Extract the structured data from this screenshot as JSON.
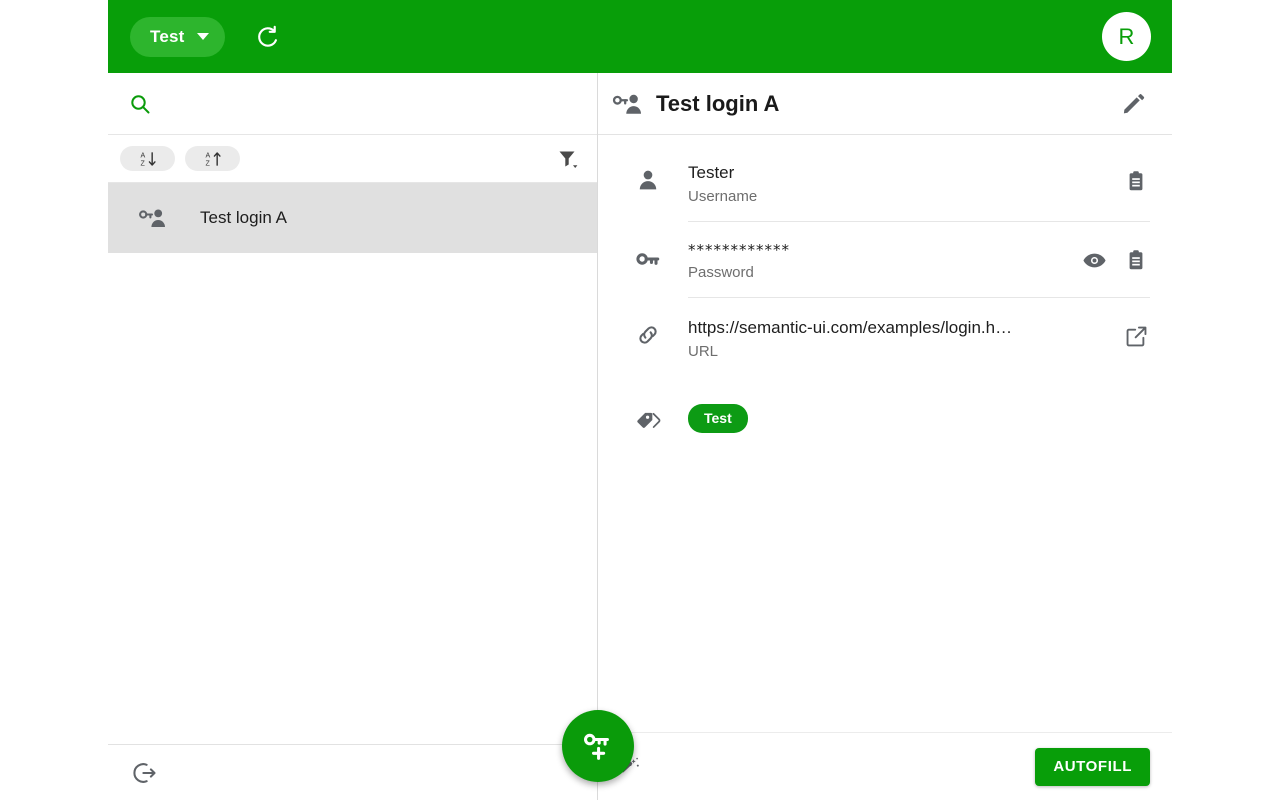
{
  "theme": {
    "primary_green": "#089e09",
    "chip_green": "#2db52d",
    "tag_green": "#0d9b14",
    "selected_row_bg": "#e0e0e0",
    "divider": "#e6e6e6"
  },
  "topbar": {
    "vault_label": "Test",
    "vault_caret_icon": "chevron-down-icon",
    "refresh_icon": "refresh-icon",
    "avatar_initial": "R"
  },
  "left_pane": {
    "search": {
      "icon": "search-icon",
      "value": "",
      "placeholder": ""
    },
    "sort": {
      "chips": [
        {
          "icon": "sort-alpha-down-icon",
          "label": ""
        },
        {
          "icon": "sort-alpha-up-icon",
          "label": ""
        }
      ],
      "filter_icon": "filter-icon"
    },
    "entries": [
      {
        "icon": "login-key-person-icon",
        "title": "Test login A",
        "selected": true
      }
    ],
    "footer": {
      "logout_icon": "logout-icon"
    },
    "fab": {
      "icon": "add-key-icon",
      "label": ""
    }
  },
  "detail": {
    "header": {
      "icon": "login-key-person-icon",
      "title": "Test login A",
      "edit_icon": "pencil-icon"
    },
    "fields": [
      {
        "icon": "person-icon",
        "value": "Tester",
        "label": "Username",
        "masked": false,
        "actions": [
          {
            "icon": "copy-icon"
          }
        ],
        "separator": true
      },
      {
        "icon": "key-icon",
        "value": "************",
        "label": "Password",
        "masked": true,
        "actions": [
          {
            "icon": "eye-icon"
          },
          {
            "icon": "copy-icon"
          }
        ],
        "separator": true
      },
      {
        "icon": "link-icon",
        "value": "https://semantic-ui.com/examples/login.h…",
        "label": "URL",
        "masked": false,
        "actions": [
          {
            "icon": "open-external-icon"
          }
        ],
        "separator": false
      }
    ],
    "tags": {
      "icon": "tag-icon",
      "items": [
        {
          "label": "Test"
        }
      ]
    },
    "footer": {
      "wand_icon": "magic-wand-icon",
      "autofill_label": "AUTOFILL"
    }
  }
}
